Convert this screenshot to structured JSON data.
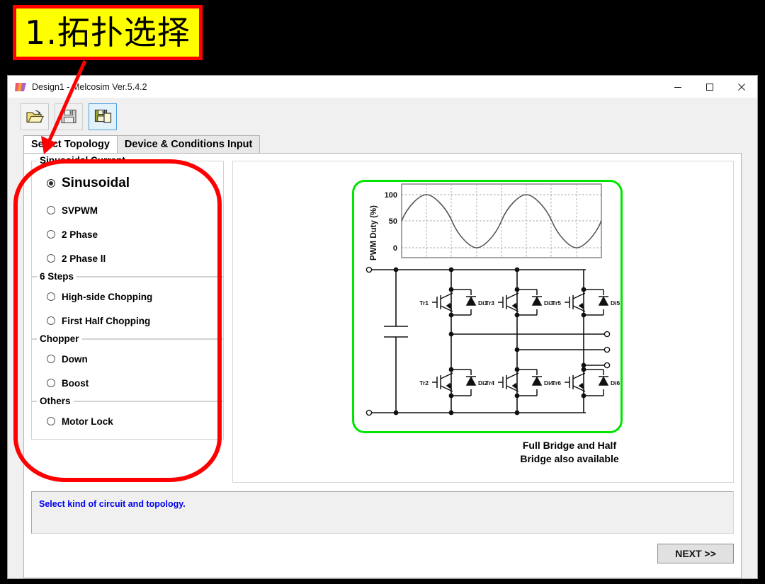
{
  "annotation": {
    "label_text": "1.拓扑选择",
    "label_bg": "#ffff00",
    "label_border": "#ff0000",
    "marker_color": "#ff0000"
  },
  "window": {
    "title": "Design1 - Melcosim Ver.5.4.2",
    "icon": "melcosim-app-icon",
    "controls": {
      "minimize": "minimize-icon",
      "maximize": "maximize-icon",
      "close": "close-icon"
    }
  },
  "toolbar": {
    "buttons": [
      {
        "name": "open-file-button",
        "icon": "open-folder-icon",
        "state": "enabled"
      },
      {
        "name": "save-button",
        "icon": "floppy-disk-icon",
        "state": "disabled"
      },
      {
        "name": "save-as-button",
        "icon": "save-as-icon",
        "state": "selected"
      }
    ]
  },
  "tabs": [
    {
      "label": "Select Topology",
      "active": true
    },
    {
      "label": "Device & Conditions Input",
      "active": false
    }
  ],
  "options": {
    "groups": [
      {
        "title": "Sinusoidal Current",
        "items": [
          {
            "label": "Sinusoidal",
            "checked": true,
            "emphasis": true
          },
          {
            "label": "SVPWM",
            "checked": false,
            "emphasis": false
          },
          {
            "label": "2 Phase",
            "checked": false,
            "emphasis": false
          },
          {
            "label": "2 Phase ll",
            "checked": false,
            "emphasis": false
          }
        ]
      },
      {
        "title": "6 Steps",
        "items": [
          {
            "label": "High-side Chopping",
            "checked": false,
            "emphasis": false
          },
          {
            "label": "First Half Chopping",
            "checked": false,
            "emphasis": false
          }
        ]
      },
      {
        "title": "Chopper",
        "items": [
          {
            "label": "Down",
            "checked": false,
            "emphasis": false
          },
          {
            "label": "Boost",
            "checked": false,
            "emphasis": false
          }
        ]
      },
      {
        "title": "Others",
        "items": [
          {
            "label": "Motor Lock",
            "checked": false,
            "emphasis": false
          }
        ]
      }
    ]
  },
  "diagram": {
    "highlight_color": "#00e400",
    "caption_line1": "Full Bridge and Half",
    "caption_line2": "Bridge also available",
    "chart": {
      "ylabel": "PWM Duty (%)",
      "yticks": [
        "100",
        "50",
        "0"
      ]
    },
    "transistors": [
      "Tr1",
      "Tr3",
      "Tr5",
      "Tr2",
      "Tr4",
      "Tr6"
    ],
    "diodes": [
      "Di1",
      "Di3",
      "Di5",
      "Di2",
      "Di4",
      "Di6"
    ]
  },
  "status": {
    "message": "Select kind of circuit and topology."
  },
  "footer": {
    "next_label": "NEXT >>"
  },
  "chart_data": {
    "type": "line",
    "title": "",
    "xlabel": "",
    "ylabel": "PWM Duty (%)",
    "ylim": [
      0,
      110
    ],
    "yticks": [
      0,
      50,
      100
    ],
    "grid": true,
    "legend": "none",
    "series": [
      {
        "name": "PWM Duty",
        "description": "Two full sinusoidal cycles oscillating between 0% and 100% duty, starting at 50% and rising",
        "x": [
          0,
          0.0625,
          0.125,
          0.1875,
          0.25,
          0.3125,
          0.375,
          0.4375,
          0.5,
          0.5625,
          0.625,
          0.6875,
          0.75,
          0.8125,
          0.875,
          0.9375,
          1.0
        ],
        "values": [
          50,
          69,
          85,
          96,
          100,
          96,
          85,
          69,
          50,
          31,
          15,
          4,
          0,
          4,
          15,
          31,
          50
        ]
      }
    ]
  }
}
